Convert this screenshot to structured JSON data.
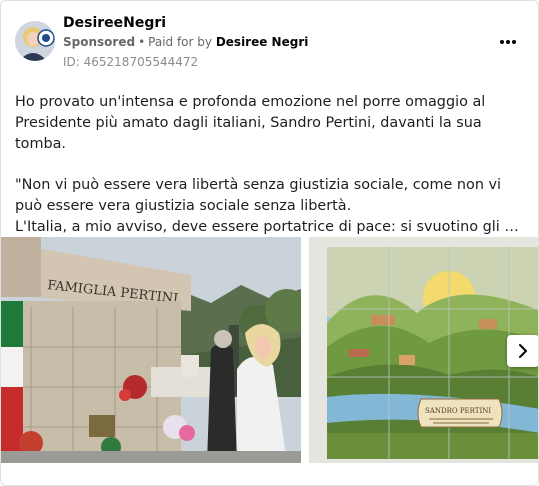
{
  "post": {
    "author_name": "DesireeNegri",
    "sponsored_label": "Sponsored",
    "separator": "•",
    "paid_for_prefix": "Paid for by",
    "paid_for_name": "Desiree Negri",
    "ad_id": "ID: 465218705544472",
    "body_paragraph_1": "Ho provato un'intensa e profonda emozione nel porre omaggio al Presidente più amato dagli italiani, Sandro Pertini, davanti la sua tomba.",
    "body_quote_line_1": "\"Non vi può essere vera libertà senza giustizia sociale, come non vi può essere vera giustizia sociale senza libertà.",
    "body_quote_line_2": "L'Italia, a mio avviso, deve essere portatrice di pace: si svuotino gli arsenali di guerra, sorgente di morte, si colmino i granai, sorgente di vita per milio…"
  },
  "carousel": {
    "photo_1": {
      "tomb_inscription": "FAMIGLIA PERTINI"
    },
    "photo_2": {
      "scroll_text": "SANDRO PERTINI"
    }
  },
  "icons": {
    "more": "more-options-icon",
    "next": "chevron-right-icon"
  },
  "colors": {
    "text_primary": "#050505",
    "text_secondary": "#65676b",
    "border": "#dddfe2"
  }
}
